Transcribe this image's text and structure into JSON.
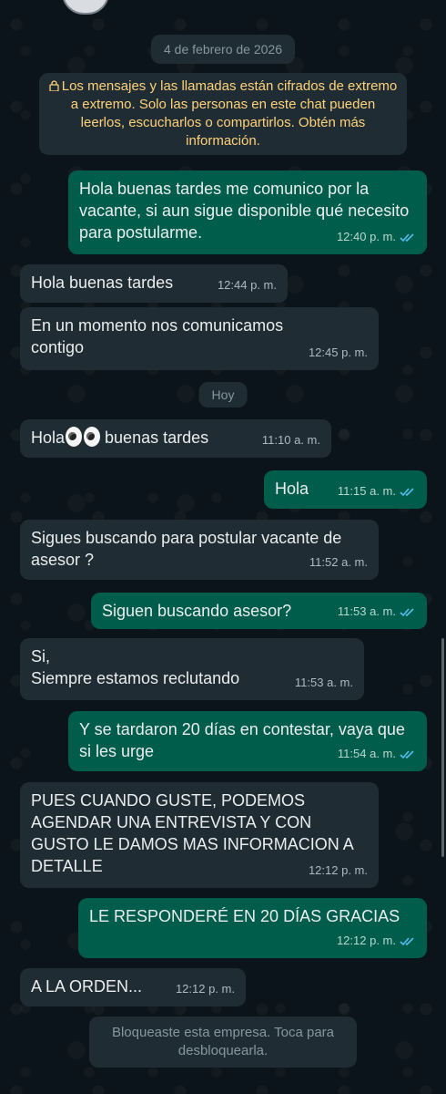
{
  "chat": {
    "date_label": "4 de febrero de 2026",
    "encryption_notice": "Los mensajes y las llamadas están cifrados de extremo a extremo. Solo las personas en este chat pueden leerlos, escucharlos o compartirlos. Obtén más información.",
    "today_label": "Hoy",
    "footer": "Bloqueaste esta empresa. Toca para desbloquearla."
  },
  "messages": [
    {
      "text": "Hola buenas tardes me comunico por la vacante, si aun sigue disponible qué necesito para postularme.",
      "time": "12:40 p. m.",
      "direction": "out",
      "read": true
    },
    {
      "text": "Hola buenas tardes",
      "time": "12:44 p. m.",
      "direction": "in"
    },
    {
      "text": "En un momento nos comunicamos contigo",
      "time": "12:45 p. m.",
      "direction": "in"
    },
    {
      "text_before": "Hola",
      "text_after": "buenas tardes",
      "emoji": "eyes",
      "time": "11:10 a. m.",
      "direction": "in"
    },
    {
      "text": "Hola",
      "time": "11:15 a. m.",
      "direction": "out",
      "read": true
    },
    {
      "text": "Sigues buscando para postular vacante de asesor ?",
      "time": "11:52 a. m.",
      "direction": "in"
    },
    {
      "text": "Siguen buscando asesor?",
      "time": "11:53 a. m.",
      "direction": "out",
      "read": true
    },
    {
      "text_line1": "Si,",
      "text_line2": "Siempre estamos reclutando",
      "time": "11:53 a. m.",
      "direction": "in"
    },
    {
      "text": "Y se tardaron 20 días en contestar, vaya que si les urge",
      "time": "11:54 a. m.",
      "direction": "out",
      "read": true
    },
    {
      "text": "PUES CUANDO GUSTE, PODEMOS AGENDAR UNA ENTREVISTA Y CON GUSTO LE DAMOS MAS INFORMACION A DETALLE",
      "time": "12:12 p. m.",
      "direction": "in"
    },
    {
      "text": "LE RESPONDERÉ EN 20 DÍAS GRACIAS",
      "time": "12:12 p. m.",
      "direction": "out",
      "read": true
    },
    {
      "text": "A LA ORDEN...",
      "time": "12:12 p. m.",
      "direction": "in"
    }
  ],
  "colors": {
    "background": "#0b141a",
    "incoming_bubble": "#202c33",
    "outgoing_bubble": "#005c4b",
    "read_ticks": "#53bdeb",
    "notice_text": "#ffd279"
  }
}
